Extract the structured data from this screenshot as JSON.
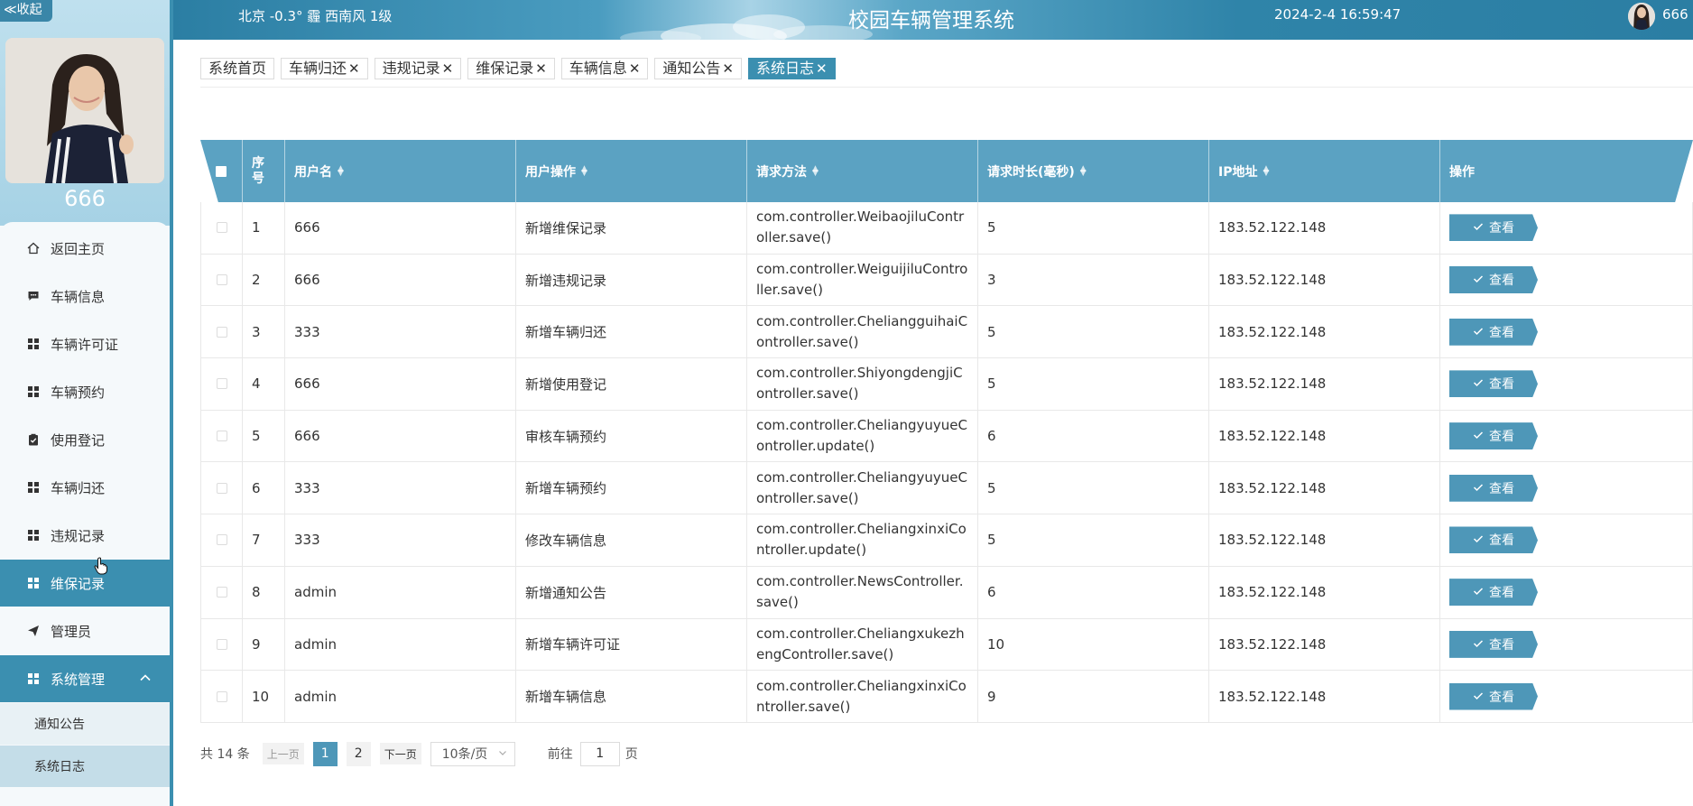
{
  "sidebar": {
    "collapse_label": "≪收起",
    "user_name": "666",
    "items": [
      {
        "label": "返回主页",
        "icon": "home-icon"
      },
      {
        "label": "车辆信息",
        "icon": "chat-icon"
      },
      {
        "label": "车辆许可证",
        "icon": "grid-icon"
      },
      {
        "label": "车辆预约",
        "icon": "grid-icon"
      },
      {
        "label": "使用登记",
        "icon": "clipboard-icon"
      },
      {
        "label": "车辆归还",
        "icon": "grid-icon"
      },
      {
        "label": "违规记录",
        "icon": "grid-icon"
      },
      {
        "label": "维保记录",
        "icon": "grid-icon"
      },
      {
        "label": "管理员",
        "icon": "send-icon"
      }
    ],
    "group": {
      "label": "系统管理",
      "icon": "grid-icon"
    },
    "sub_items": [
      {
        "label": "通知公告"
      },
      {
        "label": "系统日志"
      }
    ]
  },
  "header": {
    "weather": "北京  -0.3°  霾  西南风  1级",
    "title": "校园车辆管理系统",
    "datetime": "2024-2-4 16:59:47",
    "user": "666"
  },
  "tabs": [
    {
      "label": "系统首页",
      "closable": false
    },
    {
      "label": "车辆归还",
      "closable": true
    },
    {
      "label": "违规记录",
      "closable": true
    },
    {
      "label": "维保记录",
      "closable": true
    },
    {
      "label": "车辆信息",
      "closable": true
    },
    {
      "label": "通知公告",
      "closable": true
    },
    {
      "label": "系统日志",
      "closable": true,
      "active": true
    }
  ],
  "tab_close": "✕",
  "table": {
    "headers": {
      "index": "序号",
      "username": "用户名",
      "operation": "用户操作",
      "method": "请求方法",
      "duration": "请求时长(毫秒)",
      "ip": "IP地址",
      "actions": "操作"
    },
    "view_label": "查看",
    "rows": [
      {
        "index": "1",
        "username": "666",
        "operation": "新增维保记录",
        "method": "com.controller.WeibaojiluController.save()",
        "duration": "5",
        "ip": "183.52.122.148"
      },
      {
        "index": "2",
        "username": "666",
        "operation": "新增违规记录",
        "method": "com.controller.WeiguijiluController.save()",
        "duration": "3",
        "ip": "183.52.122.148"
      },
      {
        "index": "3",
        "username": "333",
        "operation": "新增车辆归还",
        "method": "com.controller.CheliangguihaiController.save()",
        "duration": "5",
        "ip": "183.52.122.148"
      },
      {
        "index": "4",
        "username": "666",
        "operation": "新增使用登记",
        "method": "com.controller.ShiyongdengjiController.save()",
        "duration": "5",
        "ip": "183.52.122.148"
      },
      {
        "index": "5",
        "username": "666",
        "operation": "审核车辆预约",
        "method": "com.controller.CheliangyuyueController.update()",
        "duration": "6",
        "ip": "183.52.122.148"
      },
      {
        "index": "6",
        "username": "333",
        "operation": "新增车辆预约",
        "method": "com.controller.CheliangyuyueController.save()",
        "duration": "5",
        "ip": "183.52.122.148"
      },
      {
        "index": "7",
        "username": "333",
        "operation": "修改车辆信息",
        "method": "com.controller.CheliangxinxiController.update()",
        "duration": "5",
        "ip": "183.52.122.148"
      },
      {
        "index": "8",
        "username": "admin",
        "operation": "新增通知公告",
        "method": "com.controller.NewsController.save()",
        "duration": "6",
        "ip": "183.52.122.148"
      },
      {
        "index": "9",
        "username": "admin",
        "operation": "新增车辆许可证",
        "method": "com.controller.CheliangxukezhengController.save()",
        "duration": "10",
        "ip": "183.52.122.148"
      },
      {
        "index": "10",
        "username": "admin",
        "operation": "新增车辆信息",
        "method": "com.controller.CheliangxinxiController.save()",
        "duration": "9",
        "ip": "183.52.122.148"
      }
    ]
  },
  "pagination": {
    "total": "共 14 条",
    "prev": "上一页",
    "pages": [
      "1",
      "2"
    ],
    "current": "1",
    "next": "下一页",
    "page_size": "10条/页",
    "goto": "前往",
    "goto_value": "1",
    "page_unit": "页"
  },
  "colors": {
    "primary": "#3b8fb0",
    "table_header": "#5ba2c2",
    "button": "#4e97b8"
  }
}
